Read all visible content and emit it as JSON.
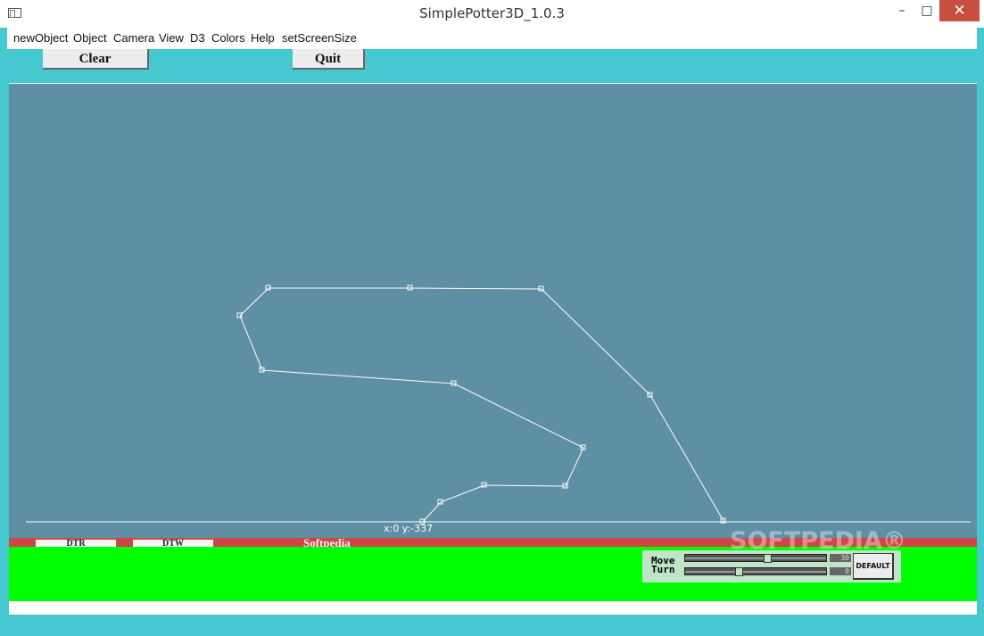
{
  "window": {
    "title": "SimplePotter3D_1.0.3"
  },
  "window_controls": {
    "minimize": "–",
    "maximize": "□",
    "close": "✕"
  },
  "menu": [
    "newObject",
    "Object",
    "Camera",
    "View",
    "D3",
    "Colors",
    "Help",
    "setScreenSize"
  ],
  "toolbar": {
    "clear_label": "Clear",
    "quit_label": "Quit"
  },
  "canvas": {
    "background": "#5f8fa5",
    "line_color": "#ffffff",
    "coordinate_readout": "x:0 y:-337"
  },
  "red_bar": {
    "button1": "DTR",
    "button2": "DTW",
    "watermark": "Softpedia"
  },
  "controls": {
    "move_label": "Move",
    "turn_label": "Turn",
    "move_value": "30",
    "turn_value": "0",
    "default_label": "DEFAULT"
  },
  "watermark": "SOFTPEDIA®",
  "colors": {
    "frame": "#45c8d0",
    "green_panel": "#00ff00",
    "red_bar": "#cf4646"
  }
}
